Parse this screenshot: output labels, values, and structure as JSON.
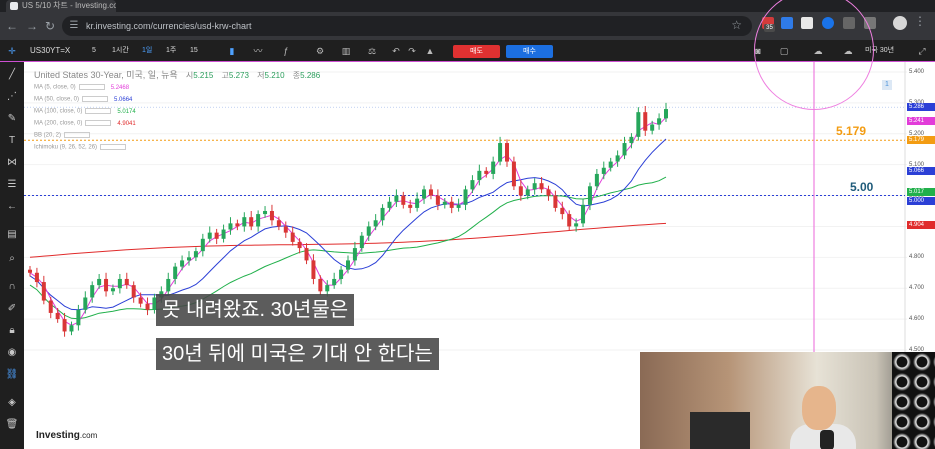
{
  "browser": {
    "tab_title": "US 5/10 차트 - Investing.com",
    "url": "kr.investing.com/currencies/usd-krw-chart",
    "badge_count": "35"
  },
  "toolbar": {
    "symbol": "US30YT=X",
    "timeframes": [
      "5",
      "1시간",
      "1일",
      "1주",
      "15"
    ],
    "active_timeframe": "1일",
    "sell_label": "매도",
    "buy_label": "매수",
    "timezone_label": "미국 30년"
  },
  "chart": {
    "title": "United States 30-Year, 미국, 일, 뉴욕",
    "ohlc": [
      {
        "label": "시",
        "value": "5.215"
      },
      {
        "label": "고",
        "value": "5.273"
      },
      {
        "label": "저",
        "value": "5.210"
      },
      {
        "label": "종",
        "value": "5.286"
      }
    ],
    "indicators": [
      {
        "name": "MA (5, close, 0)",
        "value": "5.2468",
        "color": "#e23cd9"
      },
      {
        "name": "MA (50, close, 0)",
        "value": "5.0664",
        "color": "#2b3fd6"
      },
      {
        "name": "MA (100, close, 0)",
        "value": "5.0174",
        "color": "#21b04b"
      },
      {
        "name": "MA (200, close, 0)",
        "value": "4.9041",
        "color": "#e02b2b"
      },
      {
        "name": "BB (20, 2)",
        "value": "",
        "color": "#999999"
      },
      {
        "name": "Ichimoku (9, 26, 52, 26)",
        "value": "",
        "color": "#999999"
      }
    ],
    "y_ticks": [
      "5.400",
      "5.300",
      "5.200",
      "5.100",
      "5.000",
      "4.900",
      "4.800",
      "4.700",
      "4.600",
      "4.500"
    ],
    "price_tags": [
      {
        "label": "5.286",
        "color": "#2b3fd6"
      },
      {
        "label": "5.241",
        "color": "#e23cd9"
      },
      {
        "label": "5.179",
        "color": "#f39c12"
      },
      {
        "label": "5.066",
        "color": "#2b3fd6"
      },
      {
        "label": "5.017",
        "color": "#21b04b"
      },
      {
        "label": "5.000",
        "color": "#2b3fd6"
      },
      {
        "label": "4.904",
        "color": "#e02b2b"
      }
    ],
    "annotations": [
      {
        "text": "5.179",
        "color": "#f39c12"
      },
      {
        "text": "5.00",
        "color": "#1f5b7a"
      }
    ],
    "info_marker": "1",
    "logo_text": "Investing",
    "logo_suffix": ".com"
  },
  "chart_data": {
    "type": "candlestick",
    "y_range": [
      4.5,
      5.4
    ],
    "horizontal_lines": [
      5.179,
      5.0
    ],
    "close_series": [
      4.75,
      4.72,
      4.66,
      4.62,
      4.6,
      4.56,
      4.58,
      4.63,
      4.67,
      4.71,
      4.73,
      4.69,
      4.7,
      4.73,
      4.71,
      4.67,
      4.65,
      4.63,
      4.67,
      4.69,
      4.73,
      4.77,
      4.79,
      4.8,
      4.82,
      4.86,
      4.88,
      4.86,
      4.89,
      4.91,
      4.9,
      4.93,
      4.9,
      4.94,
      4.95,
      4.92,
      4.9,
      4.88,
      4.85,
      4.83,
      4.79,
      4.73,
      4.69,
      4.71,
      4.73,
      4.76,
      4.79,
      4.83,
      4.87,
      4.9,
      4.92,
      4.96,
      4.98,
      5.0,
      4.97,
      4.96,
      4.99,
      5.02,
      5.0,
      4.97,
      4.98,
      4.96,
      4.97,
      5.02,
      5.05,
      5.08,
      5.07,
      5.11,
      5.17,
      5.11,
      5.03,
      5.0,
      5.02,
      5.04,
      5.02,
      5.0,
      4.96,
      4.94,
      4.9,
      4.91,
      4.97,
      5.03,
      5.07,
      5.09,
      5.11,
      5.13,
      5.17,
      5.19,
      5.27,
      5.21,
      5.23,
      5.25,
      5.28
    ]
  },
  "subtitles": {
    "line1": "못 내려왔죠. 30년물은",
    "line2": "30년 뒤에 미국은 기대 안 한다는"
  }
}
